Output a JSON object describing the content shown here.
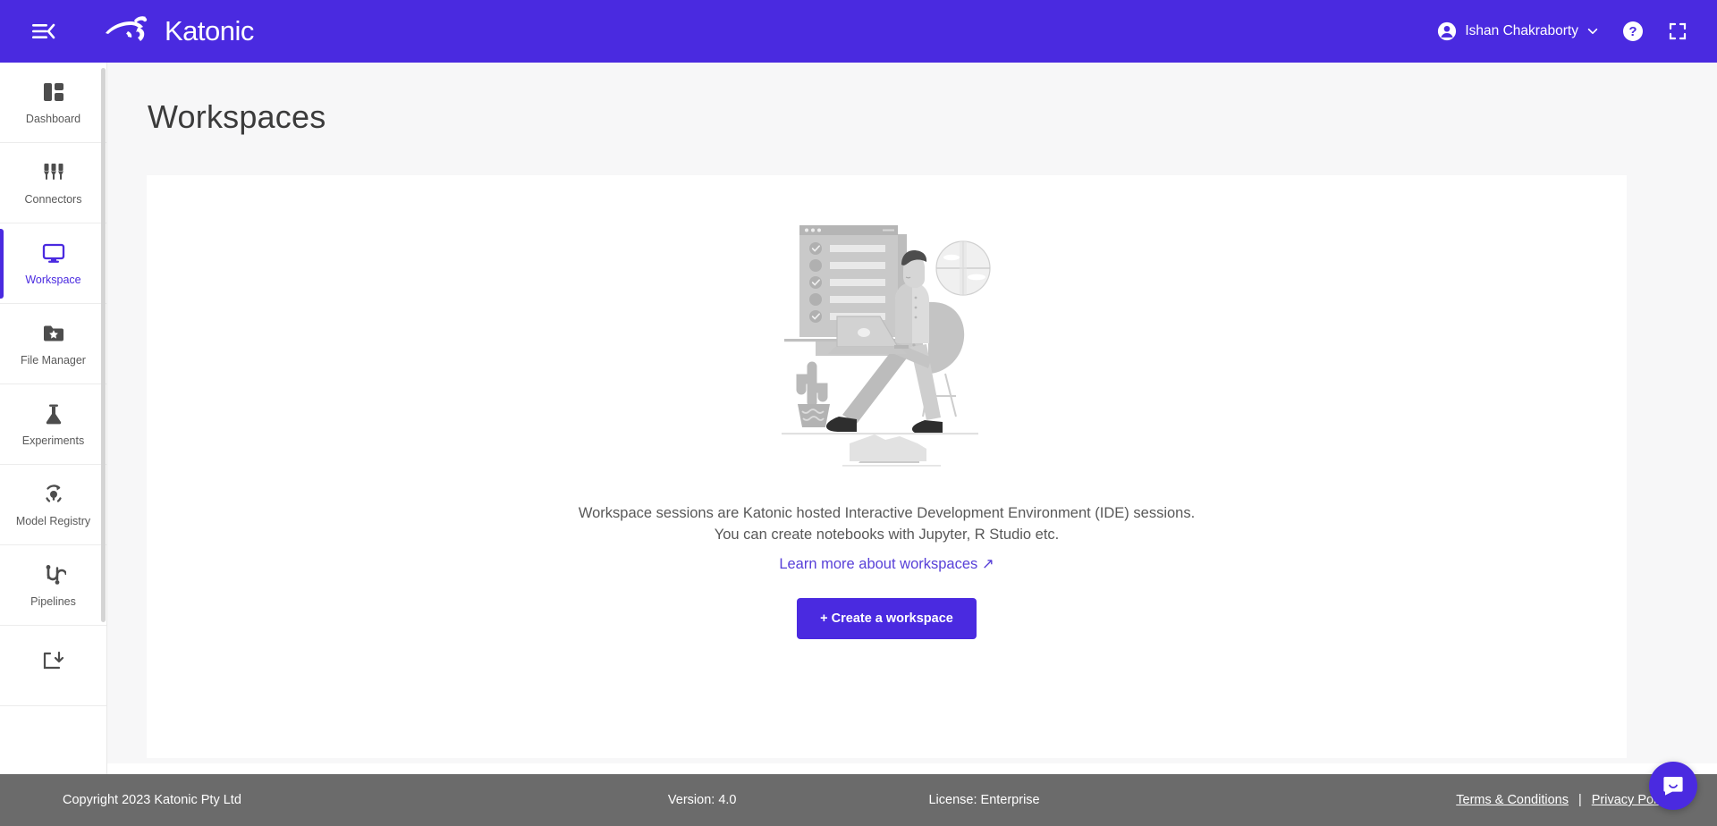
{
  "header": {
    "menu_icon": "menu-collapse-icon",
    "brand": {
      "logo_icon": "katonic-kangaroo-logo",
      "name": "Katonic"
    },
    "user": {
      "name": "Ishan Chakraborty",
      "avatar_icon": "user-avatar-icon",
      "chevron_icon": "chevron-down-icon"
    },
    "help_icon": "help-question-icon",
    "fullscreen_icon": "fullscreen-expand-icon"
  },
  "sidebar": {
    "items": [
      {
        "label": "Dashboard",
        "icon": "dashboard-grid-icon",
        "active": false
      },
      {
        "label": "Connectors",
        "icon": "connectors-plug-icon",
        "active": false
      },
      {
        "label": "Workspace",
        "icon": "workspace-monitor-icon",
        "active": true
      },
      {
        "label": "File Manager",
        "icon": "folder-star-icon",
        "active": false
      },
      {
        "label": "Experiments",
        "icon": "flask-icon",
        "active": false
      },
      {
        "label": "Model Registry",
        "icon": "model-registry-icon",
        "active": false
      },
      {
        "label": "Pipelines",
        "icon": "pipelines-icon",
        "active": false
      },
      {
        "label": "",
        "icon": "deploy-icon",
        "active": false
      }
    ]
  },
  "main": {
    "title": "Workspaces",
    "illustration": "workspace-empty-state-illustration",
    "empty_line_1": "Workspace sessions are Katonic hosted Interactive Development Environment (IDE) sessions.",
    "empty_line_2": "You can create notebooks with Jupyter, R Studio etc.",
    "learn_more": "Learn more about workspaces ↗",
    "create_button": "+ Create a workspace"
  },
  "footer": {
    "copyright": "Copyright 2023 Katonic Pty Ltd",
    "version": "Version: 4.0",
    "license": "License: Enterprise",
    "terms": "Terms & Conditions",
    "separator": "|",
    "privacy": "Privacy Policy"
  },
  "chat": {
    "icon": "chat-bubble-icon"
  },
  "colors": {
    "brand_purple": "#4A2AE0",
    "footer_gray": "#6b6b6b",
    "page_bg": "#f7f7f8",
    "link_purple": "#5840d8"
  }
}
